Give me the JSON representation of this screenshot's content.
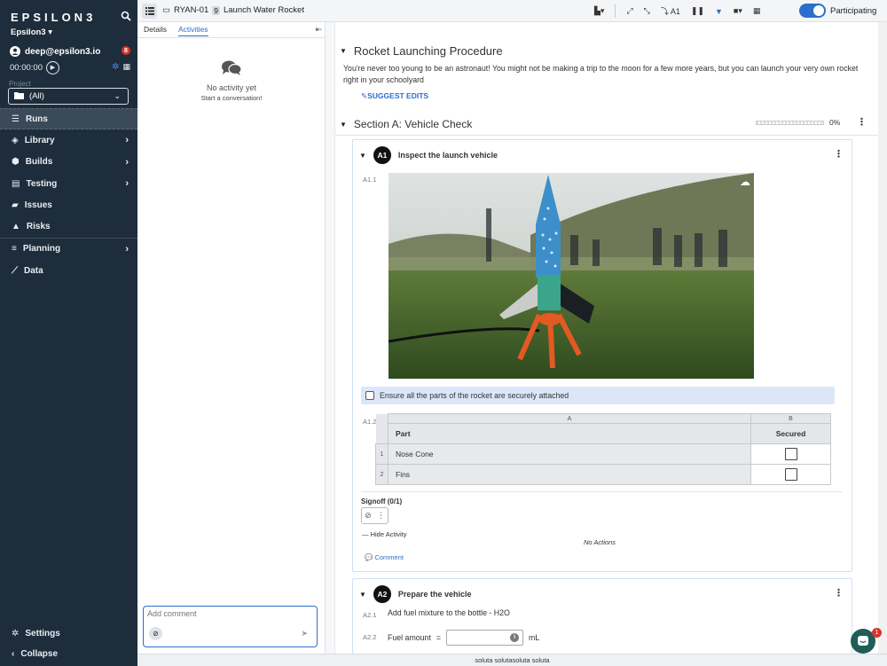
{
  "app": {
    "logo": "EPSILON3",
    "org": "Epsilon3",
    "user_email": "deep@epsilon3.io",
    "user_badge": "8",
    "timer": "00:00:00",
    "project_label": "Project",
    "project_value": "(All)"
  },
  "nav": {
    "items": [
      {
        "label": "Runs"
      },
      {
        "label": "Library"
      },
      {
        "label": "Builds"
      },
      {
        "label": "Testing"
      },
      {
        "label": "Issues"
      },
      {
        "label": "Risks"
      },
      {
        "label": "Planning"
      },
      {
        "label": "Data"
      }
    ],
    "settings": "Settings",
    "collapse": "Collapse"
  },
  "topbar": {
    "run_id": "RYAN-01",
    "run_num": "9",
    "run_title": "Launch Water Rocket",
    "step_ref": "A1",
    "participating": "Participating"
  },
  "panel": {
    "tab_details": "Details",
    "tab_activities": "Activities",
    "empty_title": "No activity yet",
    "empty_sub": "Start a conversation!",
    "comment_placeholder": "Add comment"
  },
  "procedure": {
    "title": "Rocket Launching Procedure",
    "description": "You're never too young to be an astronaut! You might not be making a trip to the moon for a few more years, but you can launch your very own rocket right in your schoolyard",
    "suggest_edits": "SUGGEST EDITS",
    "section_title": "Section A: Vehicle Check",
    "section_progress_pct": "0%",
    "section_progress_value": 0
  },
  "step_a1": {
    "num": "A1",
    "title": "Inspect the launch vehicle",
    "sub1": "A1.1",
    "sub2": "A1.2",
    "check_text": "Ensure all the parts of the rocket are securely attached",
    "table": {
      "col_letters": [
        "A",
        "B"
      ],
      "headers": [
        "Part",
        "Secured"
      ],
      "rows": [
        {
          "num": "1",
          "part": "Nose Cone"
        },
        {
          "num": "2",
          "part": "Fins"
        }
      ]
    },
    "signoff": "Signoff (0/1)",
    "hide_activity": "Hide Activity",
    "no_actions": "No Actions",
    "comment": "Comment"
  },
  "step_a2": {
    "num": "A2",
    "title": "Prepare the vehicle",
    "sub1": "A2.1",
    "sub2": "A2.2",
    "line1": "Add fuel mixture to the bottle - H2O",
    "fuel_label": "Fuel amount",
    "equals": "=",
    "unit": "mL"
  },
  "status_bar": "soluta solutasoluta soluta",
  "chat_badge": "1",
  "colors": {
    "accent": "#2c6ecb",
    "sidebar": "#1e2d3b"
  }
}
